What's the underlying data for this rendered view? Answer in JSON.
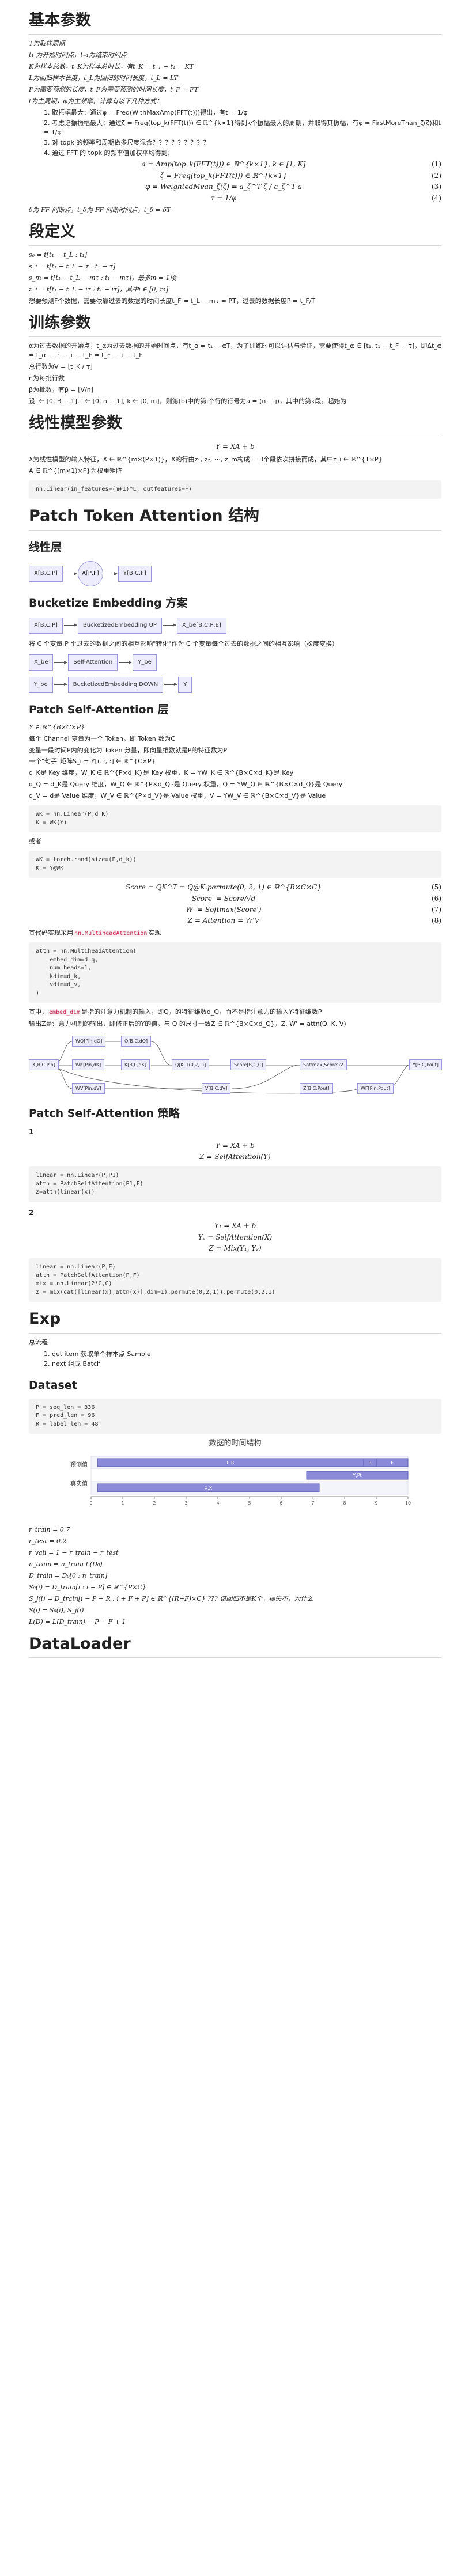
{
  "h_basic": "基本参数",
  "basic_lines": [
    "T为取样周期",
    "t₁ 为开始时间点，t₋₁为结束时间点",
    "K为样本总数，t_K为样本总时长，有t_K = t₋₁ − t₁ = KT",
    "L为回归样本长度，t_L为回归的时间长度，t_L = LT",
    "F为需要预测的长度，t_F为需要预测的时间长度，t_F = FT",
    "t为主周期，φ为主频率，计算有以下几种方式："
  ],
  "basic_list": [
    "1. 取振幅最大：通过φ = Freq(WithMaxAmp(FFT(t)))得出，有t = 1/φ",
    "2. 考虑谐振振幅最大：通过ζ = Freq(top_k(FFT(t))) ∈ ℝ^{k×1}得到k个振幅最大的周期，并取得其振幅，有φ = FirstMoreThan_ζ(ζ)和t = 1/φ",
    "3. 对 topk 的频率和周期做多尺度混合？？？？？？？？？",
    "4. 通过 FFT 的 topk 的频率值加权平均得到："
  ],
  "basic_eqs": [
    {
      "eq": "a = Amp(top_k(FFT(t))) ∈ ℝ^{k×1}, k ∈ [1, K]",
      "num": "(1)"
    },
    {
      "eq": "ζ = Freq(top_k(FFT(t))) ∈ ℝ^{k×1}",
      "num": "(2)"
    },
    {
      "eq": "φ = WeightedMean_ζ(ζ) = a_ζ^T ζ / a_ζ^T a",
      "num": "(3)"
    },
    {
      "eq": "τ = 1/φ",
      "num": "(4)"
    }
  ],
  "basic_tail": "δ为 FF 间断点，t_δ为 FF 间断时间点，t_δ = δT",
  "h_def": "段定义",
  "def_lines": [
    "s₀ = t[t₁ − t_L : t₁]",
    "s_i = t[t₁ − t_L − τ : t₁ − τ]",
    "s_m = t[t₁ − t_L − mτ : t₁ − mτ]，最多m = 1段",
    "z_i = t[t₁ − t_L − iτ : t₁ − iτ]，其中i ∈ [0, m]",
    "想要预测F个数据，需要依靠过去的数据的时间长度t_F = t_L − mτ = PT，过去的数据长度P = t_F/T"
  ],
  "h_train": "训练参数",
  "train_lines": [
    "α为过去数据的开始点，t_α为过去数据的开始时间点，有t_α = t₁ − αT，为了训练时可以评估与验证，需要使得t_α ∈ [t₁, t₁ − t_F − τ]，即Δt_α = t_α − t₁ − τ − t_F = t_F − τ − t_F",
    "总行数为V = ⌊t_K / τ⌋",
    "n为每批行数",
    "β为批数，有β = ⌊V/n⌋",
    "设l ∈ [0, B − 1], j ∈ [0, n − 1], k ∈ [0, m]，则第(b)中的第j个行的行号为a = (n − j)，其中的第k段。起始为"
  ],
  "h_linear": "线性模型参数",
  "linear_eq": "Y = XA + b",
  "linear_lines": [
    "X为线性模型的输入特征，X ∈ ℝ^{m×(P×1)}，X的行由z₁, z₂, ⋯, z_m构成 = 3个段依次拼接而成，其中z_i ∈ ℝ^{1×P}",
    "A ∈ ℝ^{(m×1)×F}为权重矩阵"
  ],
  "linear_code": "nn.Linear(in_features=(m+1)*L, outfeatures=F)",
  "h_pta": "Patch Token Attention 结构",
  "h_linear_layer": "线性层",
  "flow1": {
    "a": "X[B,C,P]",
    "b": "A[P,F]",
    "c": "Y[B,C,F]"
  },
  "h_bucket": "Bucketize Embedding 方案",
  "flow2": {
    "a": "X[B,C,P]",
    "b": "BucketizedEmbedding UP",
    "c": "X_be[B,C,P,E]"
  },
  "bucket_note": "将 C 个变量 P 个过去的数据之间的相互影响\"转化\"作为 C 个变量每个过去的数据之间的相互影响（松度变换）",
  "flow3": {
    "a": "X_be",
    "b": "Self-Attention",
    "c": "Y_be"
  },
  "flow4": {
    "a": "Y_be",
    "b": "BucketizedEmbedding DOWN",
    "c": "Y"
  },
  "h_psa": "Patch Self-Attention 层",
  "psa_lines": [
    "Y ∈ ℝ^{B×C×P}",
    "每个 Channel 变量为一个 Token，即 Token 数为C",
    "变量一段时间P内的变化为 Token 分量，即向量维数就是P的特征数为P",
    "一个\"句子\"矩阵S_i = Y[i, :, :] ∈ ℝ^{C×P}",
    "d_K是 Key 维度，W_K ∈ ℝ^{P×d_K}是 Key 权重，K = YW_K ∈ ℝ^{B×C×d_K}是 Key",
    "d_Q = d_K是 Query 维度，W_Q ∈ ℝ^{P×d_Q}是 Query 权重，Q = YW_Q ∈ ℝ^{B×C×d_Q}是 Query",
    "d_V = d是 Value 维度，W_V ∈ ℝ^{P×d_V}是 Value 权重，V = YW_V ∈ ℝ^{B×C×d_V}是 Value"
  ],
  "psa_code1": "WK = nn.Linear(P,d_K)\nK = WK(Y)",
  "psa_either": "或者",
  "psa_code2": "WK = torch.rand(size=(P,d_k))\nK = Y@WK",
  "psa_eqs": [
    {
      "eq": "Score = QK^T = Q@K.permute(0, 2, 1) ∈ ℝ^{B×C×C}",
      "num": "(5)"
    },
    {
      "eq": "Score' = Score/√d",
      "num": "(6)"
    },
    {
      "eq": "W' = Softmax(Score')",
      "num": "(7)"
    },
    {
      "eq": "Z = Attention = W'V",
      "num": "(8)"
    }
  ],
  "psa_impl": "其代码实现采用",
  "psa_impl_code": "nn.MultiheadAttention",
  "psa_impl_tail": "实现",
  "psa_code3": "attn = nn.MultiheadAttention(\n    embed_dim=d_q,\n    num_heads=1,\n    kdim=d_k,\n    vdim=d_v,\n)",
  "psa_tail1a": "其中，",
  "psa_tail1b": "embed_dim",
  "psa_tail1c": "是指的注意力机制的输入，即Q，的特征维数d_Q，而不是指注意力的输入Y特征维数P",
  "psa_tail2": "输出Z是注意力机制的输出，即修正后的Y的值，与 Q 的尺寸一致Z ∈ ℝ^{B×C×d_Q}，Z, W' = attn(Q, K, V)",
  "tree": {
    "x": "X[B,C,Pin]",
    "wq": "WQ[Pin,dQ]",
    "wk": "WK[Pin,dK]",
    "wv": "WV[Pin,dV]",
    "q": "Q[B,C,dQ]",
    "k": "K[B,C,dK]",
    "v": "V[B,C,dV]",
    "qkt": "Q[K_T(0,2,1)]",
    "score": "Score[B,C,C]",
    "softmax": "Softmax(Score')V",
    "wfin": "WF[Pin,Pout]",
    "z": "Z[B,C,Pout]",
    "y": "Y[B,C,Pout]"
  },
  "h_psa_strategy": "Patch Self-Attention 策略",
  "strat1_head": "1",
  "strat1_eqs": [
    "Y = XA + b",
    "Z = SelfAttention(Y)"
  ],
  "strat1_code": "linear = nn.Linear(P,P1)\nattn = PatchSelfAttention(P1,F)\nz=attn(linear(x))",
  "strat2_head": "2",
  "strat2_eqs": [
    "Y₁ = XA + b",
    "Y₂ = SelfAttention(X)",
    "Z = Mix(Y₁, Y₂)"
  ],
  "strat2_code": "linear = nn.Linear(P,F)\nattn = PatchSelfAttention(P,F)\nmix = nn.Linear(2*C,C)\nz = mix(cat([linear(x),attn(x)],dim=1).permute(0,2,1)).permute(0,2,1)",
  "h_exp": "Exp",
  "exp_intro": "总流程",
  "exp_list": [
    "1. get item 获取单个样本点 Sample",
    "2. next 组成 Batch"
  ],
  "h_dataset": "Dataset",
  "dataset_code": "P = seq_len = 336\nF = pred_len = 96\nR = label_len = 48",
  "gantt": {
    "title": "数据的时间结构",
    "rows": [
      "预测值",
      "真实值"
    ],
    "bars": [
      {
        "label": "P,R",
        "start": 0.02,
        "end": 0.86,
        "row": 0
      },
      {
        "label": "R",
        "start": 0.86,
        "end": 0.9,
        "row": 0
      },
      {
        "label": "F",
        "start": 0.9,
        "end": 1.0,
        "row": 0
      },
      {
        "label": "Y,Pt",
        "start": 0.68,
        "end": 1.0,
        "row": 1
      },
      {
        "label": "X,X",
        "start": 0.02,
        "end": 0.72,
        "row": 2
      }
    ],
    "ticks": [
      "0",
      "1",
      "2",
      "3",
      "4",
      "5",
      "6",
      "7",
      "8",
      "9",
      "10"
    ]
  },
  "tail_lines": [
    "r_train = 0.7",
    "r_test = 0.2",
    "r_vali = 1 − r_train − r_test",
    "n_train = n_train L(D₀)",
    "D_train = D₀[0 : n_train]",
    "S₀(i) = D_train[i : i + P] ∈ ℝ^{P×C}",
    "S_j(i) = D_train[i − P − R : i + F + P] ∈ ℝ^{(R+F)×C} ??? 该回归不是K个，损失不，为什么",
    "S(i) = S₀(i), S_j(i)",
    "L(D) = L(D_train) − P − F + 1"
  ],
  "h_dataloader": "DataLoader"
}
